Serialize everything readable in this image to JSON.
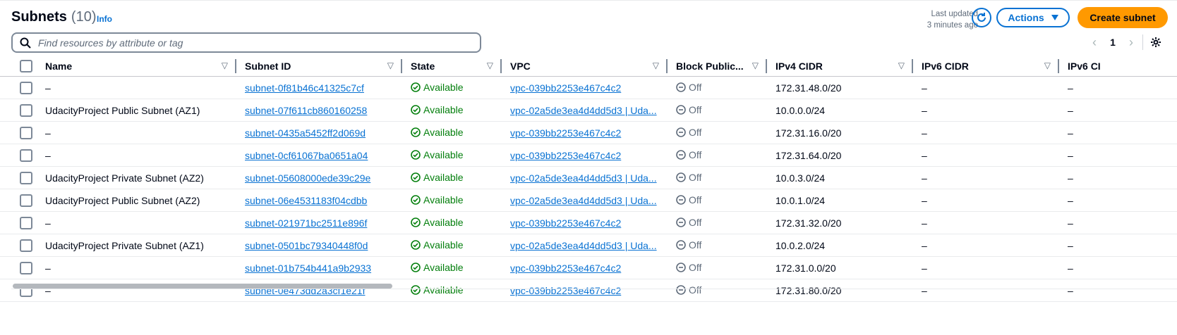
{
  "header": {
    "title": "Subnets",
    "count": "(10)",
    "info": "Info",
    "last_updated_line1": "Last updated",
    "last_updated_line2": "3 minutes ago",
    "actions_label": "Actions",
    "create_label": "Create subnet"
  },
  "search": {
    "placeholder": "Find resources by attribute or tag"
  },
  "pagination": {
    "current_page": "1"
  },
  "columns": [
    "Name",
    "Subnet ID",
    "State",
    "VPC",
    "Block Public...",
    "IPv4 CIDR",
    "IPv6 CIDR",
    "IPv6 CI"
  ],
  "rows": [
    {
      "name": "–",
      "subnet_id": "subnet-0f81b46c41325c7cf",
      "state": "Available",
      "vpc": "vpc-039bb2253e467c4c2",
      "block": "Off",
      "ipv4": "172.31.48.0/20",
      "ipv6": "–",
      "ipv6b": "–"
    },
    {
      "name": "UdacityProject Public Subnet (AZ1)",
      "subnet_id": "subnet-07f611cb860160258",
      "state": "Available",
      "vpc": "vpc-02a5de3ea4d4dd5d3 | Uda...",
      "block": "Off",
      "ipv4": "10.0.0.0/24",
      "ipv6": "–",
      "ipv6b": "–"
    },
    {
      "name": "–",
      "subnet_id": "subnet-0435a5452ff2d069d",
      "state": "Available",
      "vpc": "vpc-039bb2253e467c4c2",
      "block": "Off",
      "ipv4": "172.31.16.0/20",
      "ipv6": "–",
      "ipv6b": "–"
    },
    {
      "name": "–",
      "subnet_id": "subnet-0cf61067ba0651a04",
      "state": "Available",
      "vpc": "vpc-039bb2253e467c4c2",
      "block": "Off",
      "ipv4": "172.31.64.0/20",
      "ipv6": "–",
      "ipv6b": "–"
    },
    {
      "name": "UdacityProject Private Subnet (AZ2)",
      "subnet_id": "subnet-05608000ede39c29e",
      "state": "Available",
      "vpc": "vpc-02a5de3ea4d4dd5d3 | Uda...",
      "block": "Off",
      "ipv4": "10.0.3.0/24",
      "ipv6": "–",
      "ipv6b": "–"
    },
    {
      "name": "UdacityProject Public Subnet (AZ2)",
      "subnet_id": "subnet-06e4531183f04cdbb",
      "state": "Available",
      "vpc": "vpc-02a5de3ea4d4dd5d3 | Uda...",
      "block": "Off",
      "ipv4": "10.0.1.0/24",
      "ipv6": "–",
      "ipv6b": "–"
    },
    {
      "name": "–",
      "subnet_id": "subnet-021971bc2511e896f",
      "state": "Available",
      "vpc": "vpc-039bb2253e467c4c2",
      "block": "Off",
      "ipv4": "172.31.32.0/20",
      "ipv6": "–",
      "ipv6b": "–"
    },
    {
      "name": "UdacityProject Private Subnet (AZ1)",
      "subnet_id": "subnet-0501bc79340448f0d",
      "state": "Available",
      "vpc": "vpc-02a5de3ea4d4dd5d3 | Uda...",
      "block": "Off",
      "ipv4": "10.0.2.0/24",
      "ipv6": "–",
      "ipv6b": "–"
    },
    {
      "name": "–",
      "subnet_id": "subnet-01b754b441a9b2933",
      "state": "Available",
      "vpc": "vpc-039bb2253e467c4c2",
      "block": "Off",
      "ipv4": "172.31.0.0/20",
      "ipv6": "–",
      "ipv6b": "–"
    },
    {
      "name": "–",
      "subnet_id": "subnet-0e473dd2a3cf1e21f",
      "state": "Available",
      "vpc": "vpc-039bb2253e467c4c2",
      "block": "Off",
      "ipv4": "172.31.80.0/20",
      "ipv6": "–",
      "ipv6b": "–"
    }
  ],
  "colors": {
    "accent": "#0972d3",
    "primary_button": "#ff9900",
    "success": "#037f0c",
    "muted": "#5f6b7a"
  }
}
